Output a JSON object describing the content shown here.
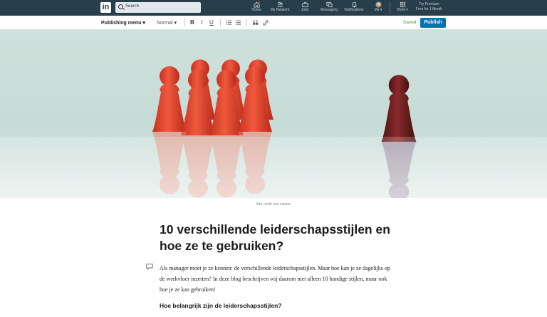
{
  "nav": {
    "logo": "in",
    "search_placeholder": "Search",
    "items": [
      {
        "label": "Home",
        "icon": "home-icon"
      },
      {
        "label": "My Network",
        "icon": "network-icon"
      },
      {
        "label": "Jobs",
        "icon": "briefcase-icon"
      },
      {
        "label": "Messaging",
        "icon": "messaging-icon"
      },
      {
        "label": "Notifications",
        "icon": "bell-icon"
      },
      {
        "label": "Me",
        "icon": "avatar"
      },
      {
        "label": "Work",
        "icon": "grid-icon"
      }
    ],
    "premium_line1": "Try Premium",
    "premium_line2": "Free for 1 Month"
  },
  "toolbar": {
    "menu_label": "Publishing menu",
    "style_label": "Normal",
    "bold": "B",
    "italic": "I",
    "underline": "U",
    "saved": "Saved",
    "publish": "Publish"
  },
  "cover": {
    "caption": "Add credit and caption"
  },
  "article": {
    "title": "10 verschillende leiderschapsstijlen en hoe ze te gebruiken?",
    "intro": "Als manager moet je ze kennen: de verschillende leiderschapsstijlen. Maar hoe kan je ze dagelijks op de werkvloer inzetten? In deze blog beschrijven wij daarom niet alleen 10 handige stijlen, maar ook hoe je ze kan gebruiken!",
    "subheading": "Hoe belangrijk zijn de leiderschapsstijlen?"
  },
  "colors": {
    "nav_bg": "#283e4a",
    "publish_bg": "#0073b1",
    "saved": "#5a8a3a",
    "pawn_red": "#e2432e",
    "pawn_dark": "#6e1d22"
  }
}
